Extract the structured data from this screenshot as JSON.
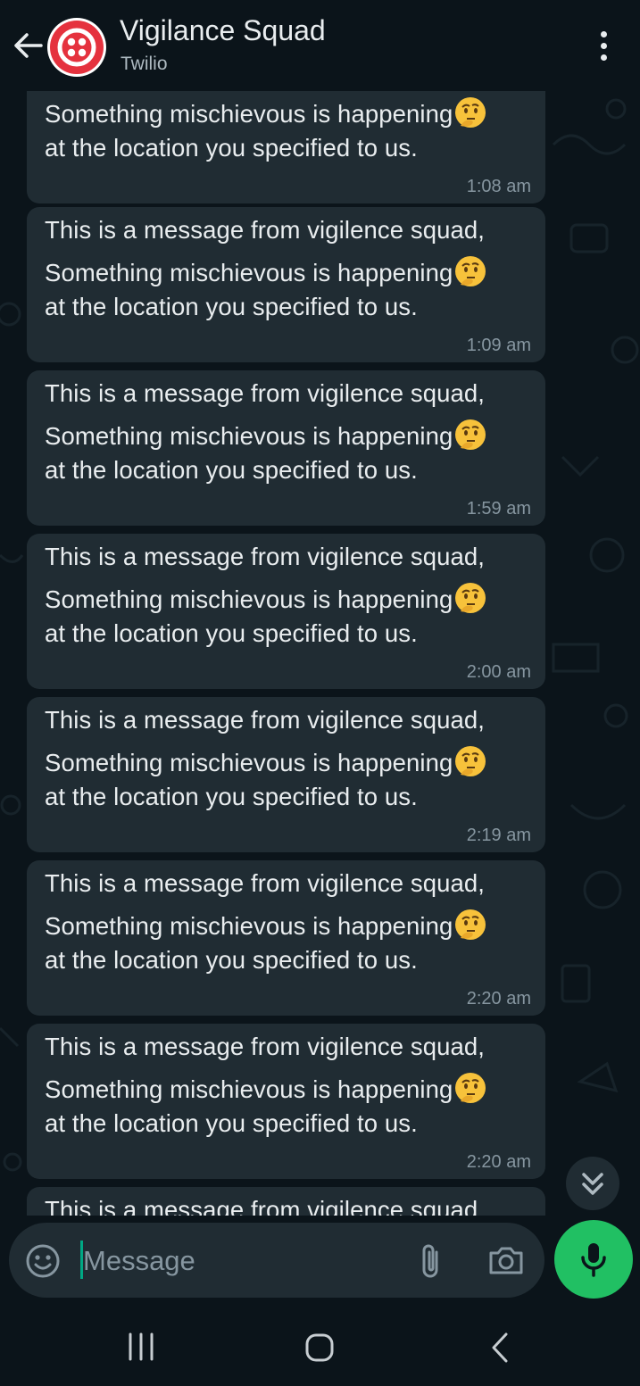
{
  "header": {
    "title": "Vigilance Squad",
    "subtitle": "Twilio"
  },
  "messages": [
    {
      "line1": "",
      "line2": "Something mischievous is happening",
      "line3": "at the location you specified to us.",
      "time": "1:08 am"
    },
    {
      "line1": "This is a message from vigilence squad,",
      "line2": "Something mischievous is happening",
      "line3": "at the location you specified to us.",
      "time": "1:09 am"
    },
    {
      "line1": "This is a message from vigilence squad,",
      "line2": "Something mischievous is happening",
      "line3": "at the location you specified to us.",
      "time": "1:59 am"
    },
    {
      "line1": "This is a message from vigilence squad,",
      "line2": "Something mischievous is happening",
      "line3": "at the location you specified to us.",
      "time": "2:00 am"
    },
    {
      "line1": "This is a message from vigilence squad,",
      "line2": "Something mischievous is happening",
      "line3": "at the location you specified to us.",
      "time": "2:19 am"
    },
    {
      "line1": "This is a message from vigilence squad,",
      "line2": "Something mischievous is happening",
      "line3": "at the location you specified to us.",
      "time": "2:20 am"
    },
    {
      "line1": "This is a message from vigilence squad,",
      "line2": "Something mischievous is happening",
      "line3": "at the location you specified to us.",
      "time": "2:20 am"
    },
    {
      "line1": "This is a message from vigilence squad,",
      "line2": "",
      "line3": "",
      "time": ""
    }
  ],
  "composer": {
    "placeholder": "Message"
  },
  "icons": {
    "back": "arrow-left-icon",
    "menu": "more-vertical-icon",
    "emoji": "smiley-icon",
    "attach": "paperclip-icon",
    "camera": "camera-icon",
    "mic": "microphone-icon",
    "scroll": "chevron-double-down-icon",
    "message_emoji": "thinking-face-emoji"
  },
  "colors": {
    "background": "#0b141a",
    "bubble": "#202c33",
    "accent_green": "#21c063",
    "twilio_red": "#e5323e",
    "timestamp": "#8696a0"
  }
}
